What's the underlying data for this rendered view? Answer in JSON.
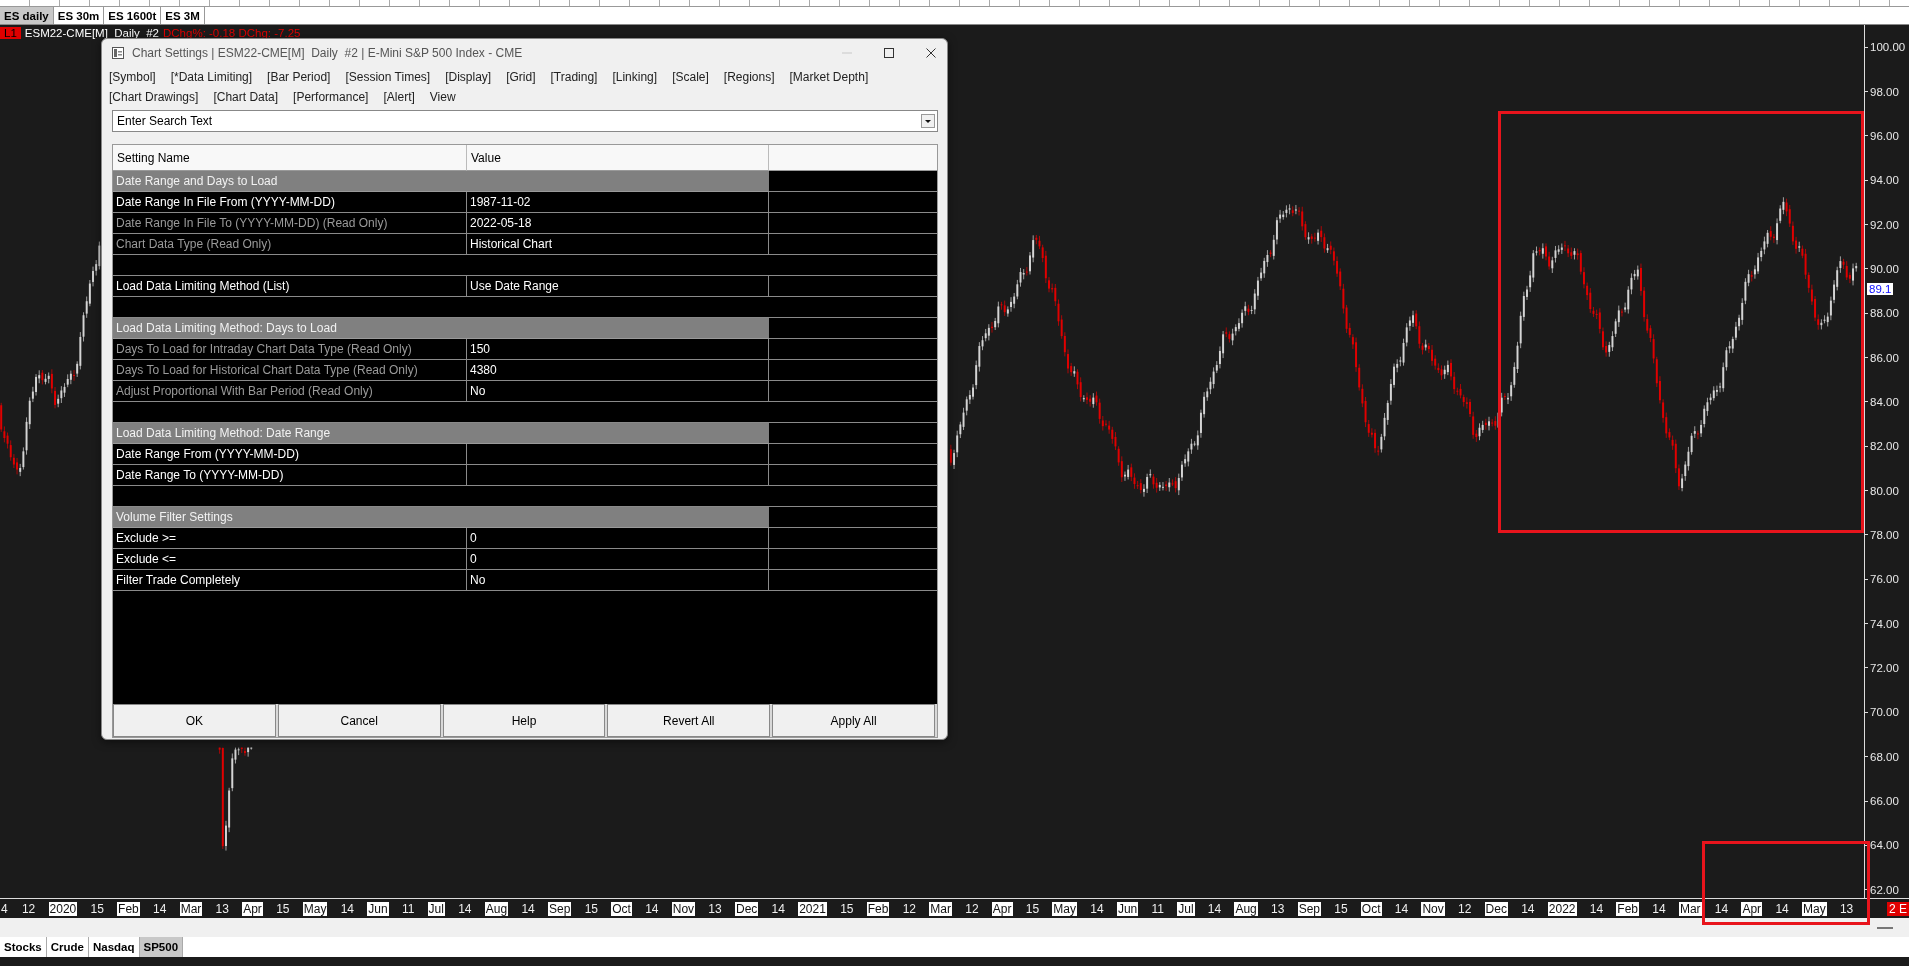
{
  "chart_tabs": [
    {
      "label": "ES daily",
      "selected": true
    },
    {
      "label": "ES 30m",
      "selected": false
    },
    {
      "label": "ES 1600t",
      "selected": false
    },
    {
      "label": "ES 3M",
      "selected": false
    }
  ],
  "chart": {
    "region_badge": "L1",
    "symbol": "ESM22-CME[M]  Daily  #2",
    "change": "DChg%: -0.18 DChg: -7.25",
    "price_labels": [
      "100.00",
      "98.00",
      "96.00",
      "94.00",
      "92.00",
      "90.00",
      "88.00",
      "86.00",
      "84.00",
      "82.00",
      "80.00",
      "78.00",
      "76.00",
      "74.00",
      "72.00",
      "70.00",
      "68.00",
      "66.00",
      "64.00",
      "62.00"
    ],
    "current_price": "89.1",
    "time_labels": [
      {
        "label": "4",
        "kind": "day"
      },
      {
        "label": "12",
        "kind": "day"
      },
      {
        "label": "2020",
        "kind": "month"
      },
      {
        "label": "15",
        "kind": "day"
      },
      {
        "label": "Feb",
        "kind": "month"
      },
      {
        "label": "14",
        "kind": "day"
      },
      {
        "label": "Mar",
        "kind": "month"
      },
      {
        "label": "13",
        "kind": "day"
      },
      {
        "label": "Apr",
        "kind": "month"
      },
      {
        "label": "15",
        "kind": "day"
      },
      {
        "label": "May",
        "kind": "month"
      },
      {
        "label": "14",
        "kind": "day"
      },
      {
        "label": "Jun",
        "kind": "month"
      },
      {
        "label": "11",
        "kind": "day"
      },
      {
        "label": "Jul",
        "kind": "month"
      },
      {
        "label": "14",
        "kind": "day"
      },
      {
        "label": "Aug",
        "kind": "month"
      },
      {
        "label": "14",
        "kind": "day"
      },
      {
        "label": "Sep",
        "kind": "month"
      },
      {
        "label": "15",
        "kind": "day"
      },
      {
        "label": "Oct",
        "kind": "month"
      },
      {
        "label": "14",
        "kind": "day"
      },
      {
        "label": "Nov",
        "kind": "month"
      },
      {
        "label": "13",
        "kind": "day"
      },
      {
        "label": "Dec",
        "kind": "month"
      },
      {
        "label": "14",
        "kind": "day"
      },
      {
        "label": "2021",
        "kind": "month"
      },
      {
        "label": "15",
        "kind": "day"
      },
      {
        "label": "Feb",
        "kind": "month"
      },
      {
        "label": "12",
        "kind": "day"
      },
      {
        "label": "Mar",
        "kind": "month"
      },
      {
        "label": "12",
        "kind": "day"
      },
      {
        "label": "Apr",
        "kind": "month"
      },
      {
        "label": "15",
        "kind": "day"
      },
      {
        "label": "May",
        "kind": "month"
      },
      {
        "label": "14",
        "kind": "day"
      },
      {
        "label": "Jun",
        "kind": "month"
      },
      {
        "label": "11",
        "kind": "day"
      },
      {
        "label": "Jul",
        "kind": "month"
      },
      {
        "label": "14",
        "kind": "day"
      },
      {
        "label": "Aug",
        "kind": "month"
      },
      {
        "label": "13",
        "kind": "day"
      },
      {
        "label": "Sep",
        "kind": "month"
      },
      {
        "label": "15",
        "kind": "day"
      },
      {
        "label": "Oct",
        "kind": "month"
      },
      {
        "label": "14",
        "kind": "day"
      },
      {
        "label": "Nov",
        "kind": "month"
      },
      {
        "label": "12",
        "kind": "day"
      },
      {
        "label": "Dec",
        "kind": "month"
      },
      {
        "label": "14",
        "kind": "day"
      },
      {
        "label": "2022",
        "kind": "month"
      },
      {
        "label": "14",
        "kind": "day"
      },
      {
        "label": "Feb",
        "kind": "month"
      },
      {
        "label": "14",
        "kind": "day"
      },
      {
        "label": "Mar",
        "kind": "month"
      },
      {
        "label": "14",
        "kind": "day"
      },
      {
        "label": "Apr",
        "kind": "month"
      },
      {
        "label": "14",
        "kind": "day"
      },
      {
        "label": "May",
        "kind": "month"
      },
      {
        "label": "13",
        "kind": "day"
      }
    ],
    "corner_badge": "2 E"
  },
  "dialog": {
    "title": "Chart Settings | ESM22-CME[M]  Daily  #2 | E-Mini S&P 500 Index - CME",
    "menu": [
      "[Symbol]",
      "[*Data Limiting]",
      "[Bar Period]",
      "[Session Times]",
      "[Display]",
      "[Grid]",
      "[Trading]",
      "[Linking]",
      "[Scale]",
      "[Regions]",
      "[Market Depth]",
      "[Chart Drawings]",
      "[Chart Data]",
      "[Performance]",
      "[Alert]",
      "View"
    ],
    "search": {
      "placeholder": "Enter Search Text"
    },
    "table": {
      "columns": [
        "Setting Name",
        "Value"
      ],
      "rows": [
        {
          "kind": "section",
          "label": "Date Range and Days to Load"
        },
        {
          "kind": "setting",
          "name": "Date Range In File From (YYYY-MM-DD)",
          "value": "1987-11-02",
          "read_only": false
        },
        {
          "kind": "setting",
          "name": "Date Range In File To (YYYY-MM-DD) (Read Only)",
          "value": "2022-05-18",
          "read_only": true
        },
        {
          "kind": "setting",
          "name": "Chart Data Type (Read Only)",
          "value": "Historical Chart",
          "read_only": true
        },
        {
          "kind": "blank"
        },
        {
          "kind": "setting",
          "name": "Load Data Limiting Method (List)",
          "value": "Use Date Range",
          "read_only": false
        },
        {
          "kind": "blank"
        },
        {
          "kind": "section",
          "label": "Load Data Limiting Method: Days to Load"
        },
        {
          "kind": "setting",
          "name": "Days To Load for Intraday Chart Data Type (Read Only)",
          "value": "150",
          "read_only": true
        },
        {
          "kind": "setting",
          "name": "Days To Load for Historical Chart Data Type (Read Only)",
          "value": "4380",
          "read_only": true
        },
        {
          "kind": "setting",
          "name": "Adjust Proportional With Bar Period (Read Only)",
          "value": "No",
          "read_only": true
        },
        {
          "kind": "blank"
        },
        {
          "kind": "section",
          "label": "Load Data Limiting Method: Date Range"
        },
        {
          "kind": "setting",
          "name": "Date Range From (YYYY-MM-DD)",
          "read_only": false
        },
        {
          "kind": "setting",
          "name": "Date Range To (YYYY-MM-DD)",
          "read_only": false
        },
        {
          "kind": "blank"
        },
        {
          "kind": "section",
          "label": "Volume Filter Settings"
        },
        {
          "kind": "setting",
          "name": "Exclude >=",
          "value": "0",
          "read_only": false
        },
        {
          "kind": "setting",
          "name": "Exclude <=",
          "value": "0",
          "read_only": false
        },
        {
          "kind": "setting",
          "name": "Filter Trade Completely",
          "value": "No",
          "read_only": false
        }
      ]
    },
    "buttons": [
      "OK",
      "Cancel",
      "Help",
      "Revert All",
      "Apply All"
    ]
  },
  "bottom_tabs": [
    {
      "label": "Stocks",
      "selected": false
    },
    {
      "label": "Crude",
      "selected": false
    },
    {
      "label": "Nasdaq",
      "selected": false
    },
    {
      "label": "SP500",
      "selected": true
    }
  ]
}
